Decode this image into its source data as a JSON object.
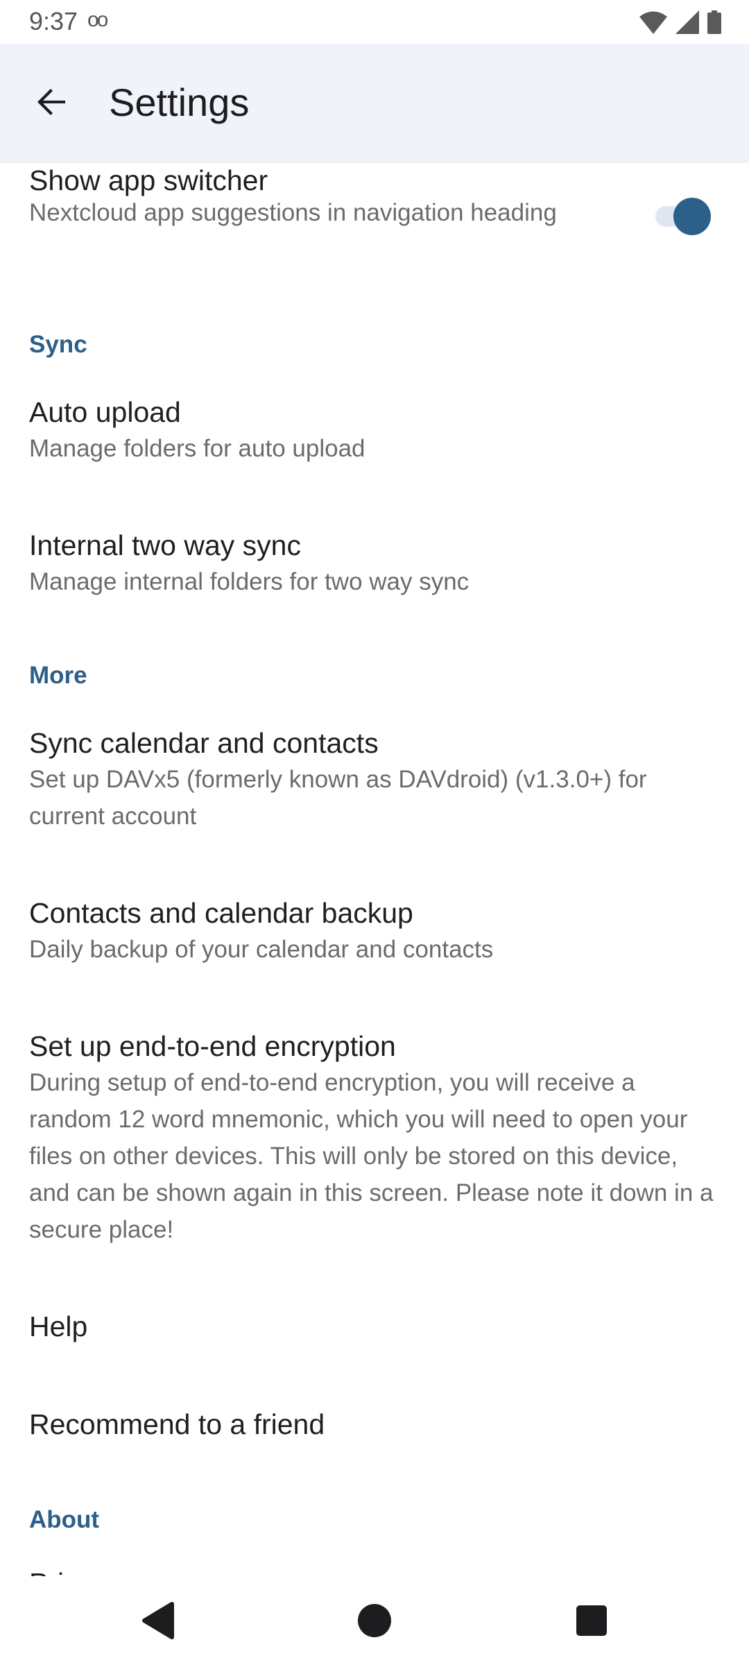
{
  "status_bar": {
    "time": "9:37",
    "extra_icon": "voicemail-icon",
    "extra_glyph": "oo"
  },
  "app_bar": {
    "title": "Settings",
    "back_icon": "arrow-back-icon"
  },
  "preferences": {
    "show_app_switcher": {
      "title": "Show app switcher",
      "summary": "Nextcloud app suggestions in navigation heading",
      "toggle_on": true
    },
    "sync_header": "Sync",
    "auto_upload": {
      "title": "Auto upload",
      "summary": "Manage folders for auto upload"
    },
    "internal_two_way_sync": {
      "title": "Internal two way sync",
      "summary": "Manage internal folders for two way sync"
    },
    "more_header": "More",
    "sync_calendar_contacts": {
      "title": "Sync calendar and contacts",
      "summary": "Set up DAVx5 (formerly known as DAVdroid) (v1.3.0+) for current account"
    },
    "contacts_calendar_backup": {
      "title": "Contacts and calendar backup",
      "summary": "Daily backup of your calendar and contacts"
    },
    "e2e_encryption": {
      "title": "Set up end-to-end encryption",
      "summary": "During setup of end-to-end encryption, you will receive a random 12 word mnemonic, which you will need to open your files on other devices. This will only be stored on this device, and can be shown again in this screen. Please note it down in a secure place!"
    },
    "help": {
      "title": "Help"
    },
    "recommend": {
      "title": "Recommend to a friend"
    },
    "about_header": "About",
    "partial_item": {
      "title": "Privacy"
    }
  },
  "colors": {
    "accent": "#2c5f8a",
    "app_bar_bg": "#f1f3fa"
  }
}
